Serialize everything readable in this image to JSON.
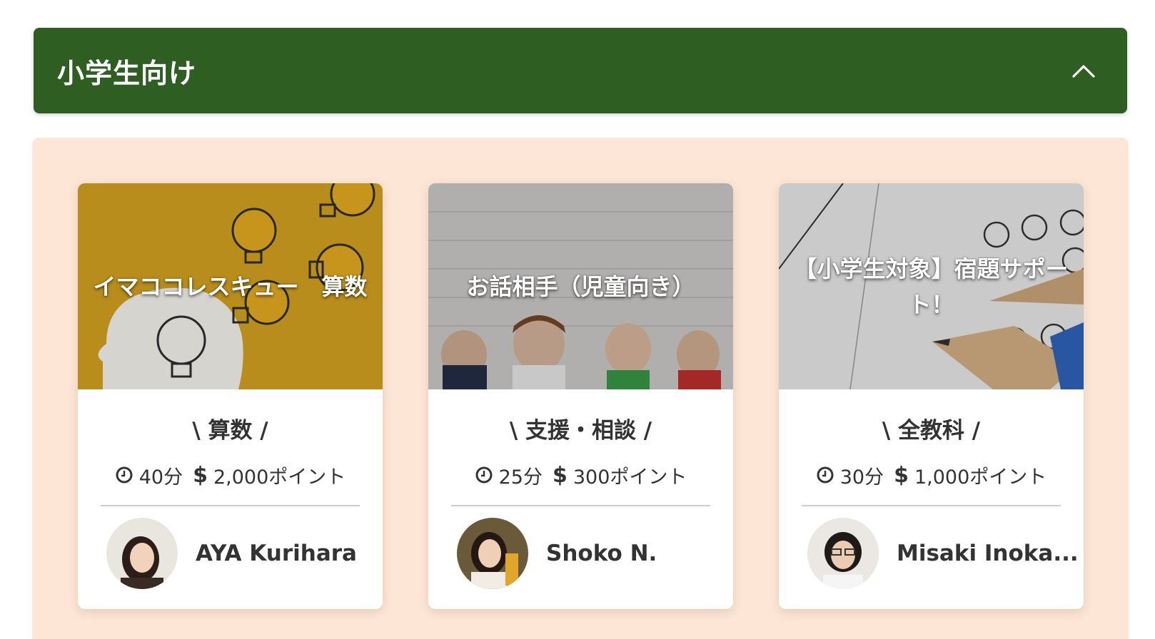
{
  "section": {
    "title": "小学生向け"
  },
  "cards": [
    {
      "image_title": "イマココレスキュー　算数",
      "category": "\\ 算数 /",
      "duration": "40分",
      "price": "2,000ポイント",
      "teacher": "AYA Kurihara"
    },
    {
      "image_title": "お話相手（児童向き）",
      "category": "\\ 支援・相談 /",
      "duration": "25分",
      "price": "300ポイント",
      "teacher": "Shoko N."
    },
    {
      "image_title": "【小学生対象】宿題サポート！",
      "category": "\\ 全教科 /",
      "duration": "30分",
      "price": "1,000ポイント",
      "teacher": "Misaki Inoka..."
    }
  ],
  "colors": {
    "header_bg": "#2f5e22",
    "panel_bg": "#fde6d6",
    "card_bg": "#ffffff",
    "text": "#333333"
  },
  "icons": {
    "collapse": "chevron-up-icon",
    "duration": "clock-icon",
    "price": "dollar-icon"
  }
}
